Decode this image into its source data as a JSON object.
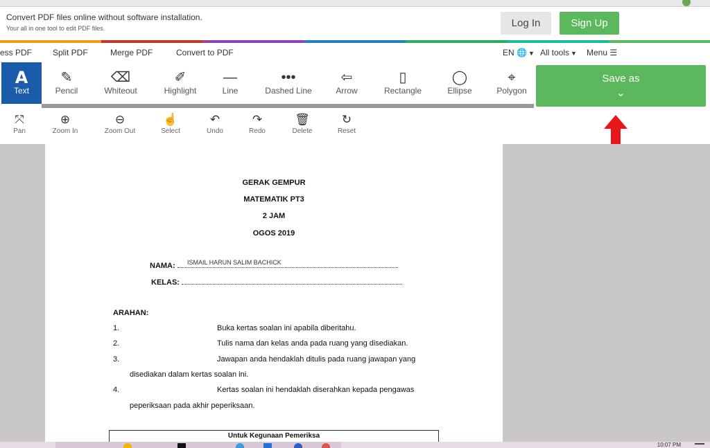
{
  "banner": {
    "tagline": "Convert PDF files online without software installation.",
    "subline": "Your all in one tool to edit PDF files.",
    "login": "Log In",
    "signup": "Sign Up"
  },
  "brand_colors": [
    "#f39c12",
    "#c0392b",
    "#8e44ad",
    "#2980b9",
    "#27ae60",
    "#1abc9c",
    "#5cb85c"
  ],
  "nav": {
    "items": [
      "ess PDF",
      "Split PDF",
      "Merge PDF",
      "Convert to PDF"
    ],
    "lang": "EN",
    "lang_icon": "globe-icon",
    "all_tools": "All tools",
    "menu": "Menu"
  },
  "tools": [
    {
      "label": "Text",
      "icon": "A"
    },
    {
      "label": "Pencil",
      "icon": "✎"
    },
    {
      "label": "Whiteout",
      "icon": "⌫"
    },
    {
      "label": "Highlight",
      "icon": "✐"
    },
    {
      "label": "Line",
      "icon": "—"
    },
    {
      "label": "Dashed Line",
      "icon": "•••"
    },
    {
      "label": "Arrow",
      "icon": "⇦"
    },
    {
      "label": "Rectangle",
      "icon": "▯"
    },
    {
      "label": "Ellipse",
      "icon": "◯"
    },
    {
      "label": "Polygon",
      "icon": "⌖"
    }
  ],
  "save": {
    "label": "Save as",
    "icon": "chevron-down-icon"
  },
  "subtools": [
    {
      "label": "Pan",
      "icon": "⤧"
    },
    {
      "label": "Zoom In",
      "icon": "⊕"
    },
    {
      "label": "Zoom Out",
      "icon": "⊖"
    },
    {
      "label": "Select",
      "icon": "☝"
    },
    {
      "label": "Undo",
      "icon": "↶"
    },
    {
      "label": "Redo",
      "icon": "↷"
    },
    {
      "label": "Delete",
      "icon": "🗑"
    },
    {
      "label": "Reset",
      "icon": "↻"
    }
  ],
  "document": {
    "title_lines": [
      "GERAK GEMPUR",
      "MATEMATIK PT3",
      "2 JAM",
      "OGOS 2019"
    ],
    "nama_label": "NAMA:",
    "nama_value": "ISMAIL HARUN SALIM BACHICK",
    "kelas_label": "KELAS:",
    "arahan": "ARAHAN:",
    "instructions": [
      {
        "num": "1.",
        "text": "Buka kertas soalan ini apabila diberitahu.",
        "cont": ""
      },
      {
        "num": "2.",
        "text": "Tulis nama dan kelas anda pada ruang yang disediakan.",
        "cont": ""
      },
      {
        "num": "3.",
        "text": "Jawapan anda hendaklah ditulis pada ruang jawapan yang",
        "cont": "disediakan dalam kertas soalan ini."
      },
      {
        "num": "4.",
        "text": "Kertas soalan ini hendaklah diserahkan kepada pengawas",
        "cont": "peperiksaan pada akhir peperiksaan."
      }
    ],
    "box_title": "Untuk Kegunaan Pemeriksa"
  },
  "taskbar": {
    "clock": "10:07 PM"
  }
}
